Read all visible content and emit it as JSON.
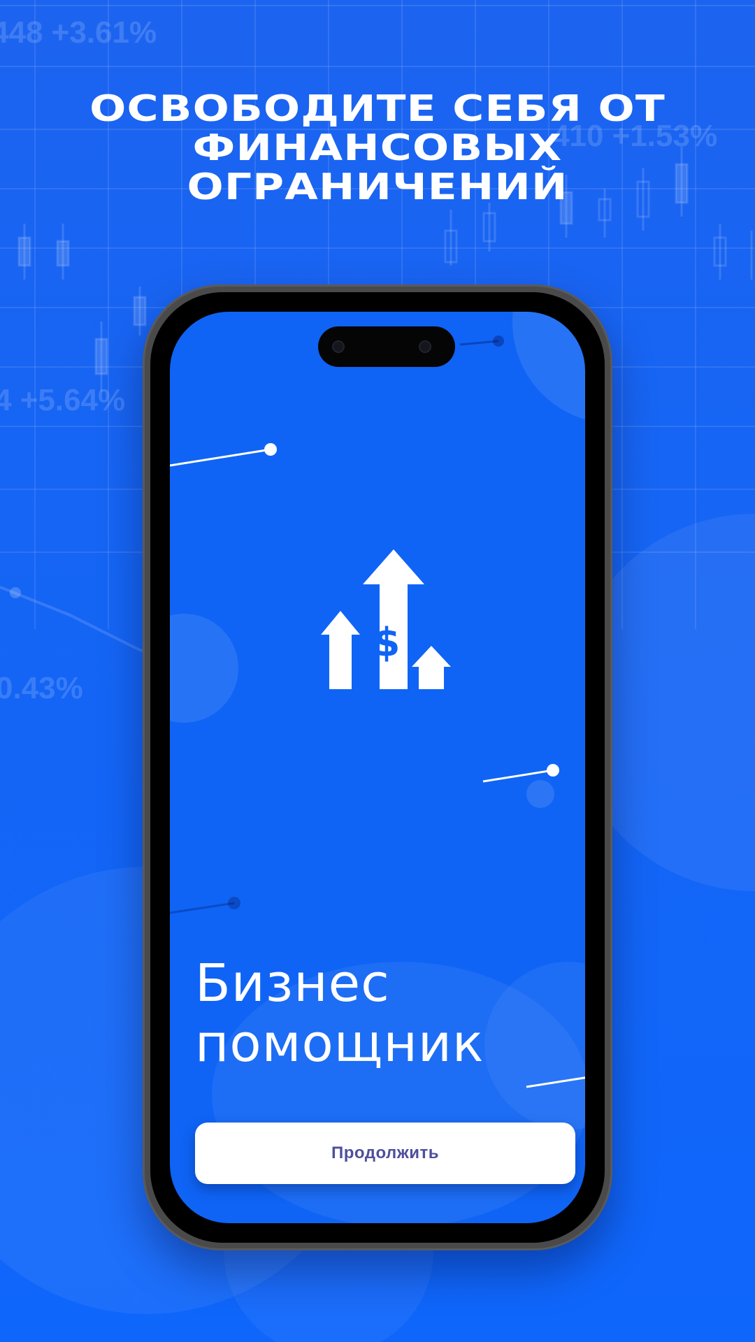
{
  "background": {
    "tickers": [
      "448 +3.61%",
      "410 +1.53%",
      "4 +5.64%",
      "0.43%"
    ]
  },
  "headline": {
    "line1": "ОСВОБОДИТЕ СЕБЯ ОТ",
    "line2": "ФИНАНСОВЫХ",
    "line3": "ОГРАНИЧЕНИЙ"
  },
  "app": {
    "logo_icon": "growth-arrows-dollar-icon",
    "logo_symbol": "$",
    "title_line1": "Бизнес",
    "title_line2": "помощник",
    "continue_label": "Продолжить"
  },
  "colors": {
    "background": "#1565f5",
    "screen": "#0f64f5",
    "button": "#ffffff",
    "button_text": "#4f4f9c"
  }
}
